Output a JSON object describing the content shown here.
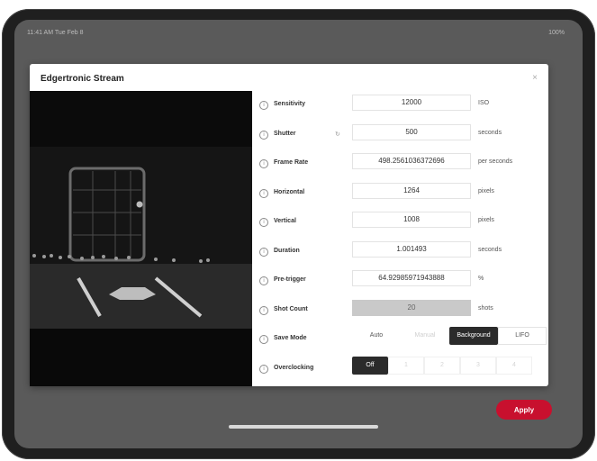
{
  "status_bar": {
    "left": "11:41 AM Tue Feb 8",
    "right": "100%"
  },
  "modal": {
    "title": "Edgertronic Stream",
    "close": "×"
  },
  "settings": [
    {
      "id": "sensitivity",
      "label": "Sensitivity",
      "value": "12000",
      "unit": "ISO"
    },
    {
      "id": "shutter",
      "label": "Shutter",
      "value": "500",
      "unit": "seconds",
      "reset": "↻"
    },
    {
      "id": "frame-rate",
      "label": "Frame Rate",
      "value": "498.2561036372696",
      "unit": "per seconds"
    },
    {
      "id": "horizontal",
      "label": "Horizontal",
      "value": "1264",
      "unit": "pixels"
    },
    {
      "id": "vertical",
      "label": "Vertical",
      "value": "1008",
      "unit": "pixels"
    },
    {
      "id": "duration",
      "label": "Duration",
      "value": "1.001493",
      "unit": "seconds"
    },
    {
      "id": "pre-trigger",
      "label": "Pre-trigger",
      "value": "64.92985971943888",
      "unit": "%"
    },
    {
      "id": "shot-count",
      "label": "Shot Count",
      "value": "20",
      "unit": "shots",
      "disabled": true
    }
  ],
  "save_mode": {
    "label": "Save Mode",
    "options": [
      "Auto",
      "Manual",
      "Background",
      "LIFO"
    ],
    "selected": "Background"
  },
  "overclocking": {
    "label": "Overclocking",
    "options": [
      "Off",
      "1",
      "2",
      "3",
      "4"
    ],
    "selected": "Off"
  },
  "apply_label": "Apply",
  "colors": {
    "accent": "#c8102e",
    "selected": "#2b2b2b",
    "screen_bg": "#5a5a5a"
  }
}
